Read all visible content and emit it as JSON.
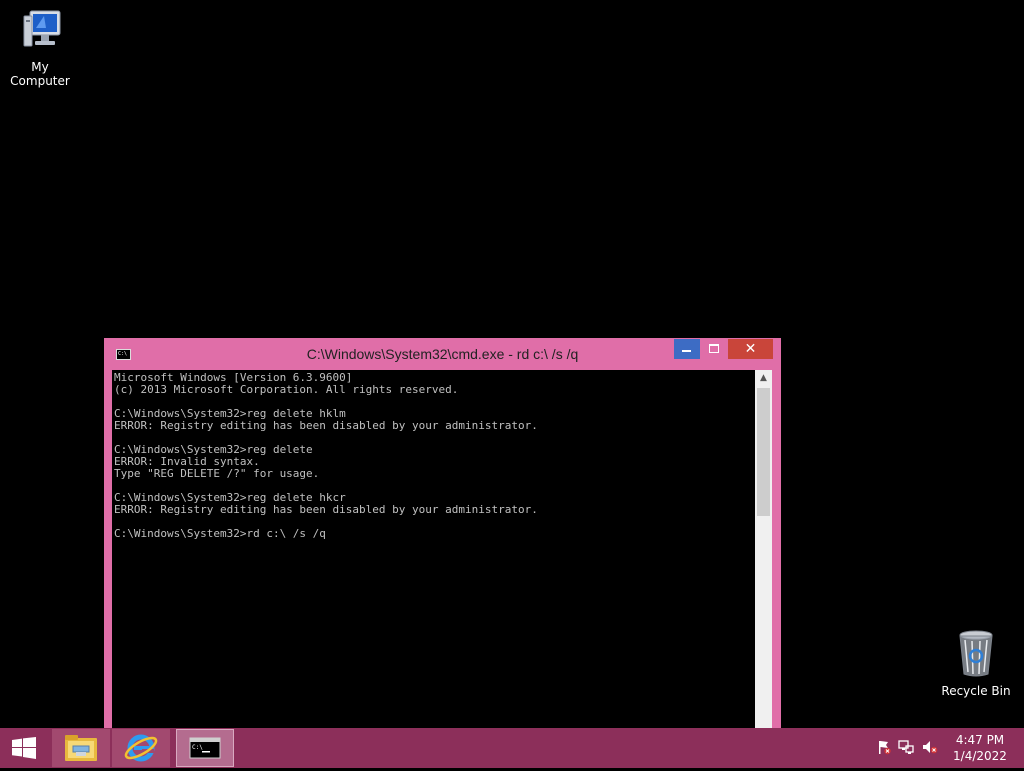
{
  "desktop": {
    "icons": [
      {
        "label": "My Computer",
        "icon": "computer-icon"
      },
      {
        "label": "Recycle Bin",
        "icon": "recycle-bin-icon"
      }
    ]
  },
  "cmd_window": {
    "title": "C:\\Windows\\System32\\cmd.exe - rd  c:\\ /s /q",
    "close_label": "✕",
    "lines": [
      "Microsoft Windows [Version 6.3.9600]",
      "(c) 2013 Microsoft Corporation. All rights reserved.",
      "",
      "C:\\Windows\\System32>reg delete hklm",
      "ERROR: Registry editing has been disabled by your administrator.",
      "",
      "C:\\Windows\\System32>reg delete",
      "ERROR: Invalid syntax.",
      "Type \"REG DELETE /?\" for usage.",
      "",
      "C:\\Windows\\System32>reg delete hkcr",
      "ERROR: Registry editing has been disabled by your administrator.",
      "",
      "C:\\Windows\\System32>rd c:\\ /s /q"
    ]
  },
  "taskbar": {
    "buttons": [
      {
        "icon": "file-explorer-icon"
      },
      {
        "icon": "internet-explorer-icon"
      },
      {
        "icon": "command-prompt-icon",
        "active": true
      }
    ],
    "tray": {
      "icons": [
        "action-center-flag-icon",
        "network-icon",
        "volume-muted-icon"
      ]
    },
    "clock": {
      "time": "4:47 PM",
      "date": "1/4/2022"
    }
  }
}
